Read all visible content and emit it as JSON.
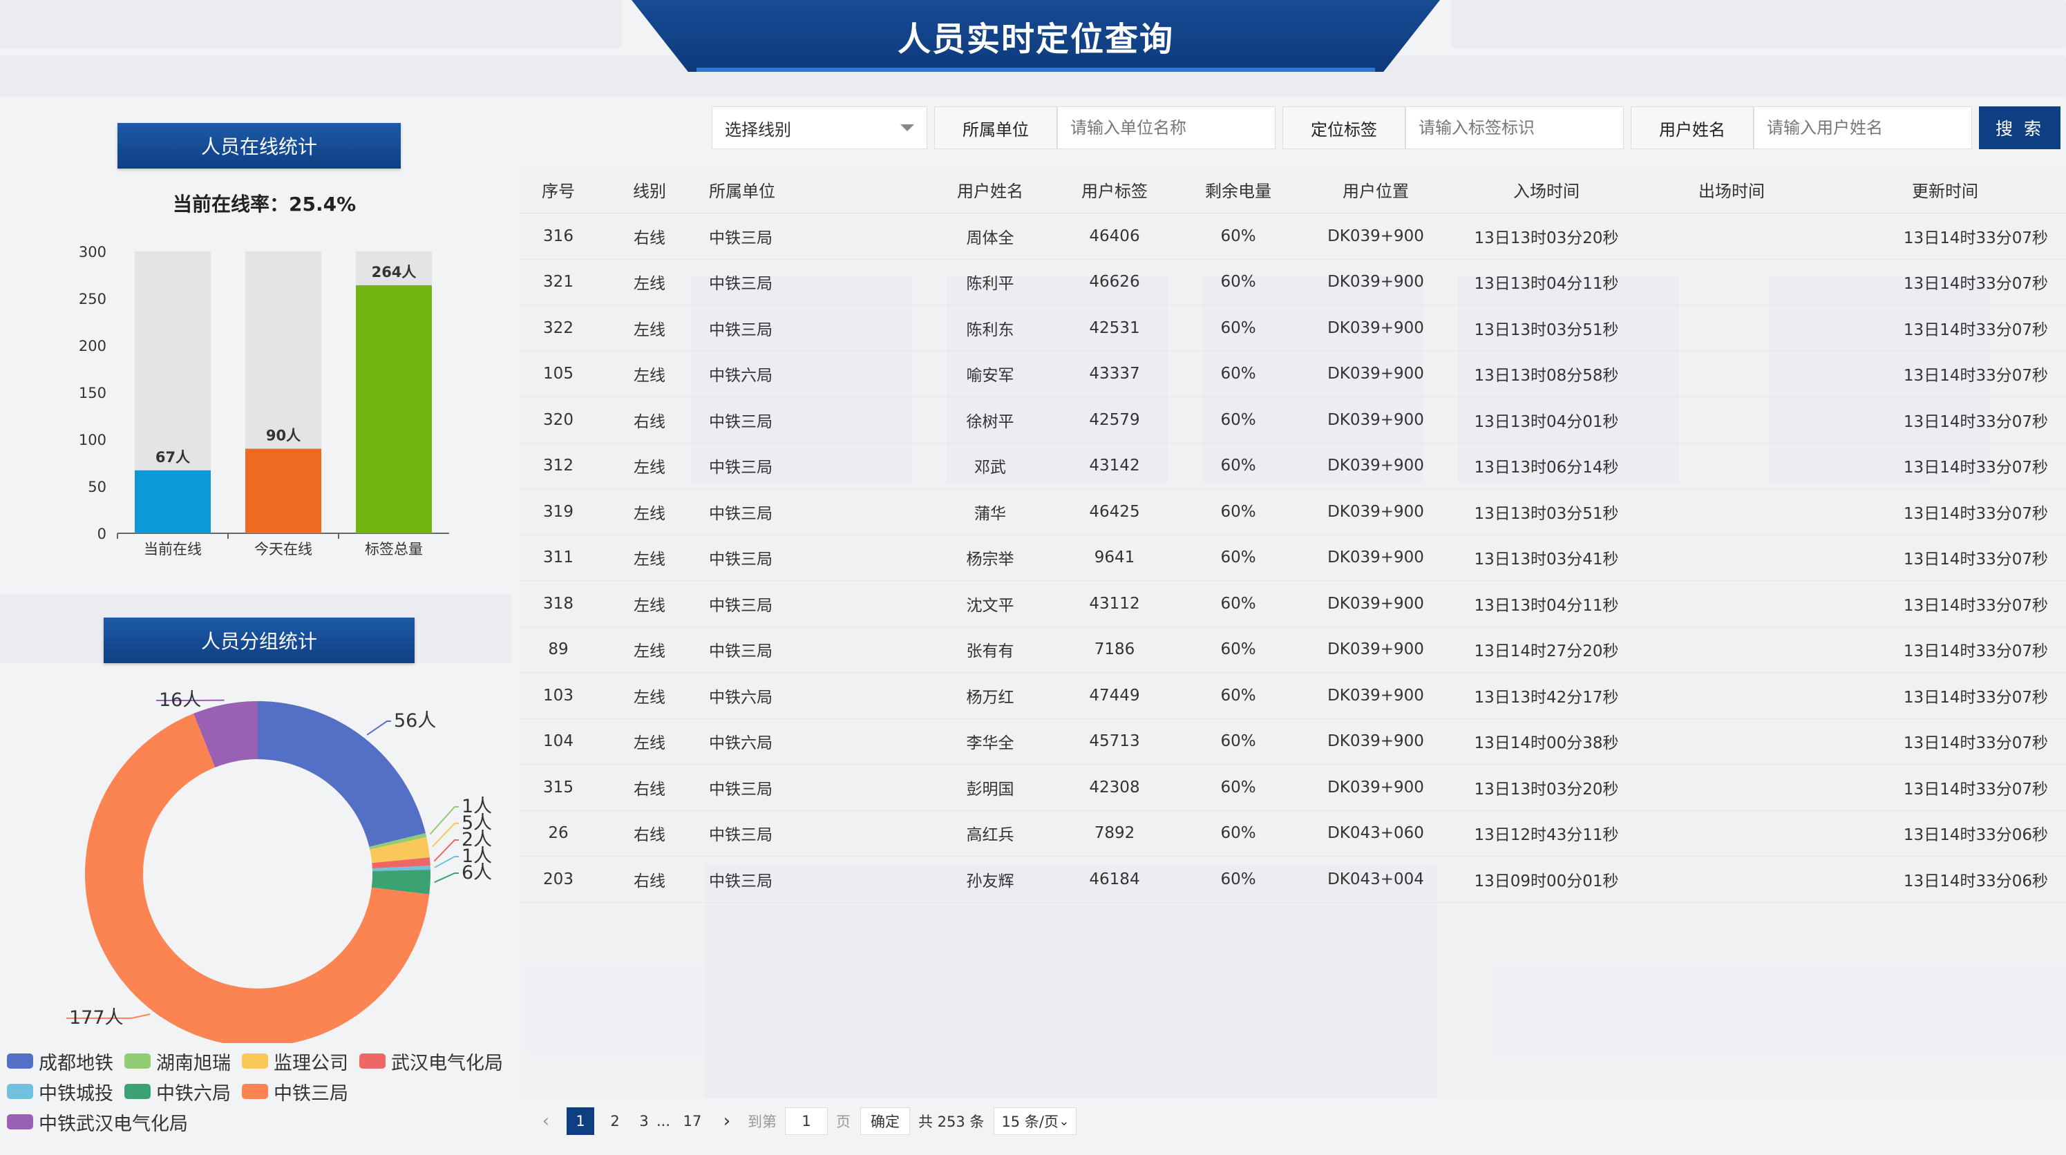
{
  "title": "人员实时定位查询",
  "online_panel": {
    "header": "人员在线统计",
    "rate_label": "当前在线率：25.4%"
  },
  "group_panel": {
    "header": "人员分组统计"
  },
  "chart_data": [
    {
      "type": "bar",
      "categories": [
        "当前在线",
        "今天在线",
        "标签总量"
      ],
      "values": [
        67,
        90,
        264
      ],
      "data_labels": [
        "67人",
        "90人",
        "264人"
      ],
      "colors": [
        "#0d98d8",
        "#ee6a20",
        "#72b50e"
      ],
      "background_bar_value": 300,
      "ylim": [
        0,
        300
      ],
      "yticks": [
        "0",
        "50",
        "100",
        "150",
        "200",
        "250",
        "300"
      ],
      "grid": false
    },
    {
      "type": "pie",
      "donut": true,
      "labels": [
        "成都地铁",
        "湖南旭瑞",
        "监理公司",
        "武汉电气化局",
        "中铁城投",
        "中铁六局",
        "中铁三局",
        "中铁武汉电气化局"
      ],
      "values": [
        56,
        1,
        5,
        2,
        1,
        6,
        177,
        16
      ],
      "data_labels": [
        "56人",
        "1人",
        "5人",
        "2人",
        "1人",
        "6人",
        "177人",
        "16人"
      ],
      "colors": [
        "#5470c6",
        "#91cc75",
        "#fac858",
        "#ee6666",
        "#73c0de",
        "#3ba272",
        "#fc8452",
        "#9a60b4"
      ],
      "legend_position": "bottom"
    }
  ],
  "search": {
    "line_select": "选择线别",
    "unit_label": "所属单位",
    "unit_placeholder": "请输入单位名称",
    "tag_label": "定位标签",
    "tag_placeholder": "请输入标签标识",
    "name_label": "用户姓名",
    "name_placeholder": "请输入用户姓名",
    "button": "搜 索"
  },
  "table": {
    "headers": [
      "序号",
      "线别",
      "所属单位",
      "用户姓名",
      "用户标签",
      "剩余电量",
      "用户位置",
      "入场时间",
      "出场时间",
      "更新时间"
    ],
    "rows": [
      [
        "316",
        "右线",
        "中铁三局",
        "周体全",
        "46406",
        "60%",
        "DK039+900",
        "13日13时03分20秒",
        "",
        "13日14时33分07秒"
      ],
      [
        "321",
        "左线",
        "中铁三局",
        "陈利平",
        "46626",
        "60%",
        "DK039+900",
        "13日13时04分11秒",
        "",
        "13日14时33分07秒"
      ],
      [
        "322",
        "左线",
        "中铁三局",
        "陈利东",
        "42531",
        "60%",
        "DK039+900",
        "13日13时03分51秒",
        "",
        "13日14时33分07秒"
      ],
      [
        "105",
        "左线",
        "中铁六局",
        "喻安军",
        "43337",
        "60%",
        "DK039+900",
        "13日13时08分58秒",
        "",
        "13日14时33分07秒"
      ],
      [
        "320",
        "右线",
        "中铁三局",
        "徐树平",
        "42579",
        "60%",
        "DK039+900",
        "13日13时04分01秒",
        "",
        "13日14时33分07秒"
      ],
      [
        "312",
        "左线",
        "中铁三局",
        "邓武",
        "43142",
        "60%",
        "DK039+900",
        "13日13时06分14秒",
        "",
        "13日14时33分07秒"
      ],
      [
        "319",
        "左线",
        "中铁三局",
        "蒲华",
        "46425",
        "60%",
        "DK039+900",
        "13日13时03分51秒",
        "",
        "13日14时33分07秒"
      ],
      [
        "311",
        "左线",
        "中铁三局",
        "杨宗举",
        "9641",
        "60%",
        "DK039+900",
        "13日13时03分41秒",
        "",
        "13日14时33分07秒"
      ],
      [
        "318",
        "左线",
        "中铁三局",
        "沈文平",
        "43112",
        "60%",
        "DK039+900",
        "13日13时04分11秒",
        "",
        "13日14时33分07秒"
      ],
      [
        "89",
        "左线",
        "中铁三局",
        "张有有",
        "7186",
        "60%",
        "DK039+900",
        "13日14时27分20秒",
        "",
        "13日14时33分07秒"
      ],
      [
        "103",
        "左线",
        "中铁六局",
        "杨万红",
        "47449",
        "60%",
        "DK039+900",
        "13日13时42分17秒",
        "",
        "13日14时33分07秒"
      ],
      [
        "104",
        "左线",
        "中铁六局",
        "李华全",
        "45713",
        "60%",
        "DK039+900",
        "13日14时00分38秒",
        "",
        "13日14时33分07秒"
      ],
      [
        "315",
        "右线",
        "中铁三局",
        "彭明国",
        "42308",
        "60%",
        "DK039+900",
        "13日13时03分20秒",
        "",
        "13日14时33分07秒"
      ],
      [
        "26",
        "右线",
        "中铁三局",
        "高红兵",
        "7892",
        "60%",
        "DK043+060",
        "13日12时43分11秒",
        "",
        "13日14时33分06秒"
      ],
      [
        "203",
        "右线",
        "中铁三局",
        "孙友辉",
        "46184",
        "60%",
        "DK043+004",
        "13日09时00分01秒",
        "",
        "13日14时33分06秒"
      ]
    ]
  },
  "pagination": {
    "prev_icon": "chevron-left-icon",
    "next_icon": "chevron-right-icon",
    "pages": [
      "1",
      "2",
      "3"
    ],
    "ellipsis": "...",
    "last_page": "17",
    "goto_label": "到第",
    "goto_value": "1",
    "page_unit": "页",
    "confirm": "确定",
    "total": "共 253 条",
    "page_size": "15 条/页"
  }
}
